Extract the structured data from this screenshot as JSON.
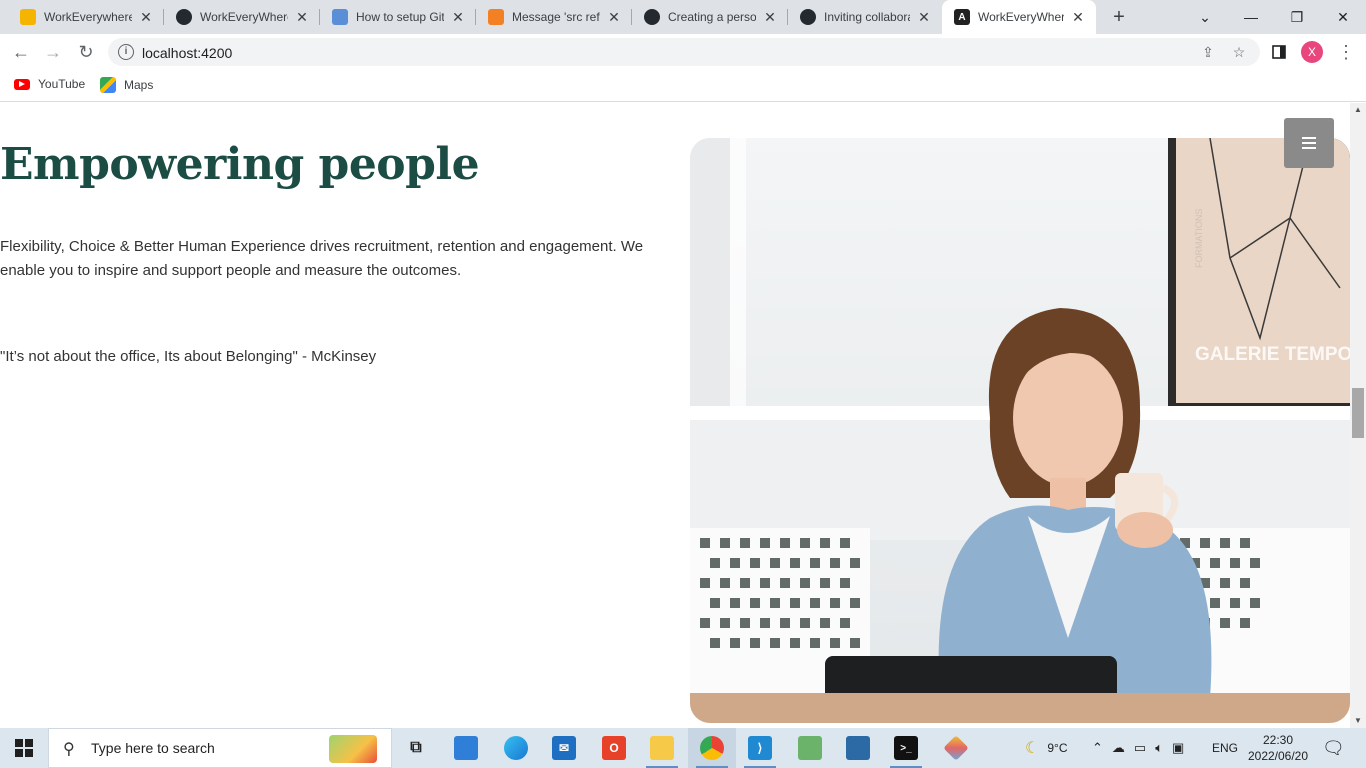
{
  "browser": {
    "tabs": [
      {
        "title": "WorkEverywhere",
        "favicon": "google-slides-icon",
        "active": false
      },
      {
        "title": "WorkEveryWhere",
        "favicon": "github-icon",
        "active": false
      },
      {
        "title": "How to setup Git",
        "favicon": "blog-icon",
        "active": false
      },
      {
        "title": "Message 'src refs",
        "favicon": "stackoverflow-icon",
        "active": false
      },
      {
        "title": "Creating a person",
        "favicon": "github-icon",
        "active": false
      },
      {
        "title": "Inviting collabora",
        "favicon": "github-icon",
        "active": false
      },
      {
        "title": "WorkEveryWhere",
        "favicon": "angular-icon",
        "active": true
      }
    ],
    "url": "localhost:4200",
    "profile_initial": "X",
    "bookmarks": [
      {
        "label": "YouTube",
        "icon": "youtube-icon"
      },
      {
        "label": "Maps",
        "icon": "maps-icon"
      }
    ]
  },
  "page": {
    "headline": "Empowering people",
    "lead": "Flexibility, Choice & Better Human Experience drives recruitment, retention and engagement. We enable you to inspire and support people and measure the outcomes.",
    "quote": "\"It’s not about the office, Its about Belonging\" - McKinsey",
    "poster_text": "GALERIE TEMPO",
    "poster_side_text": "FORMATIONS"
  },
  "taskbar": {
    "search_placeholder": "Type here to search",
    "weather": "9°C",
    "language": "ENG",
    "time": "22:30",
    "date": "2022/06/20"
  }
}
